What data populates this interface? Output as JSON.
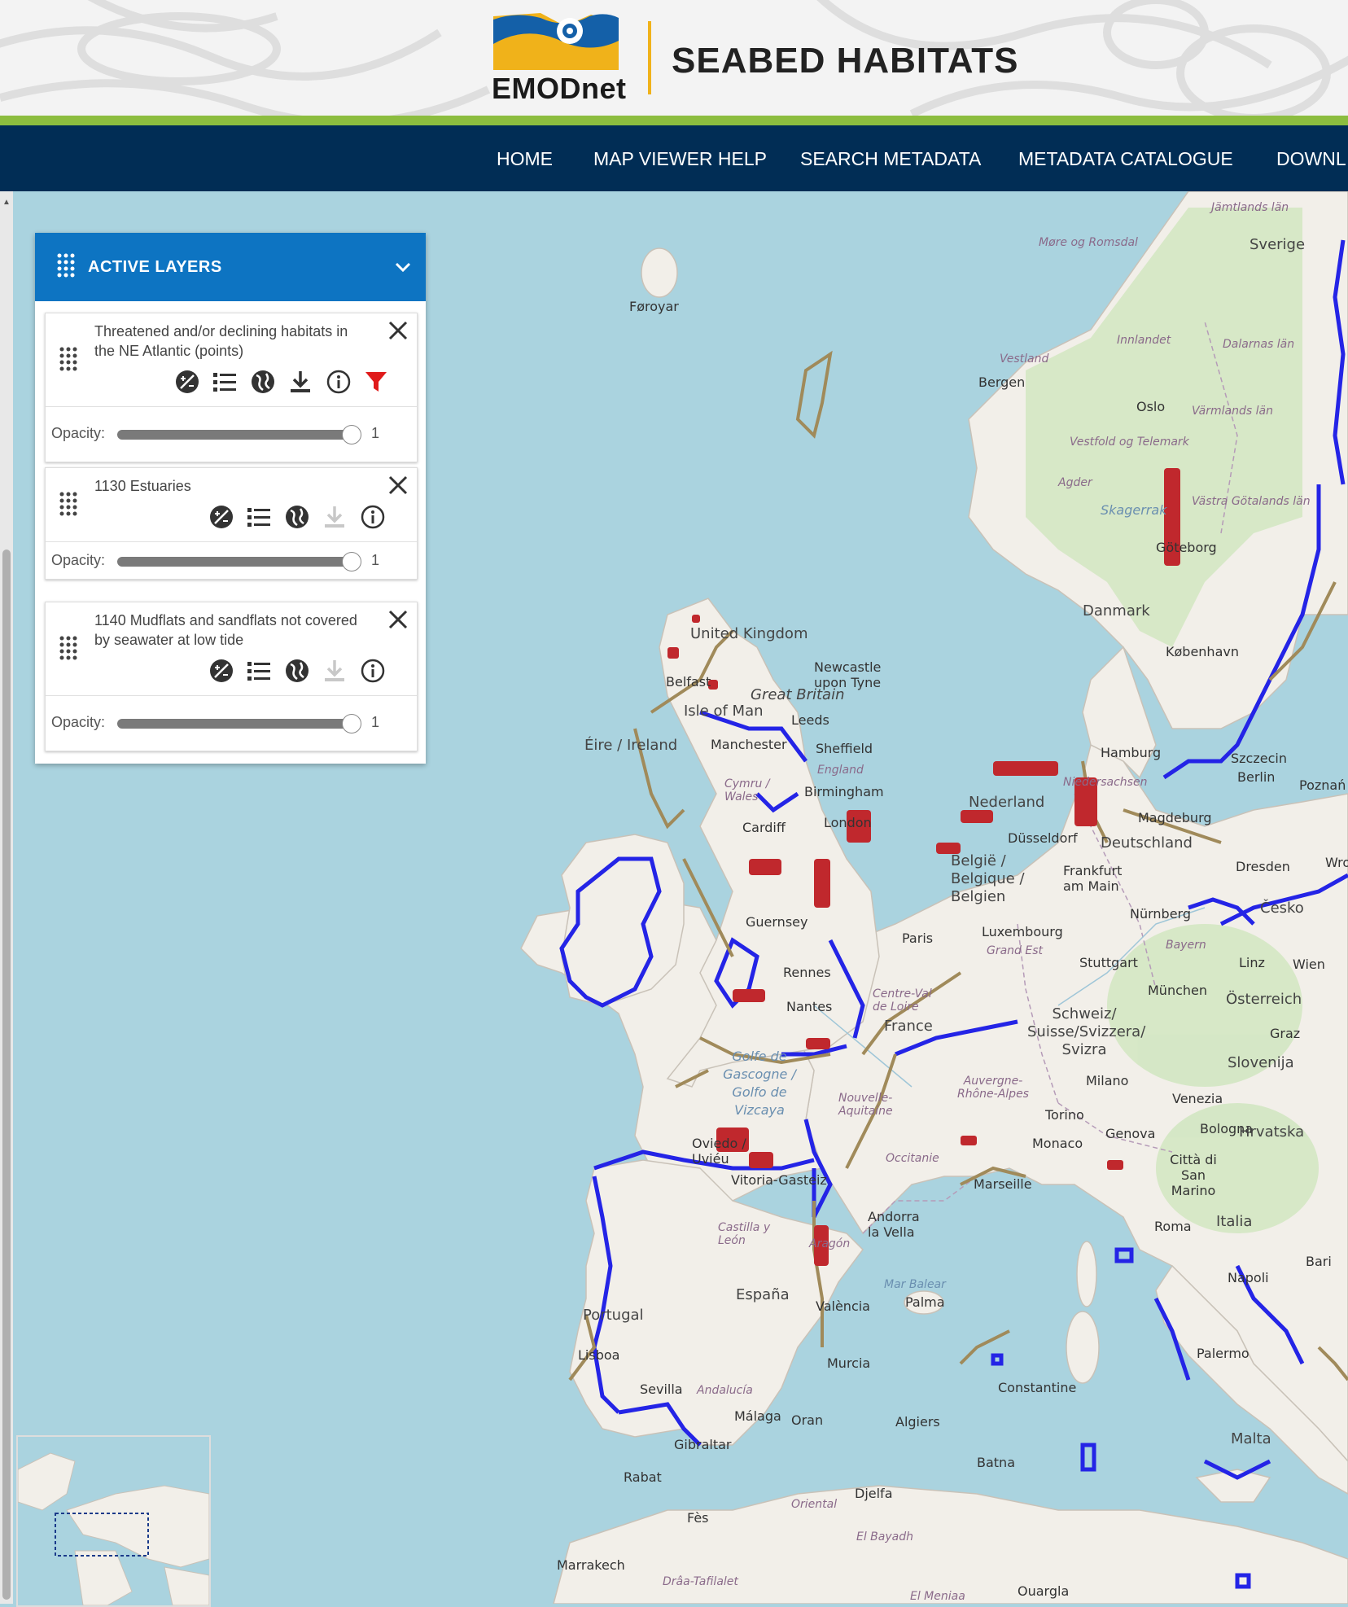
{
  "header": {
    "logo_text": "EMODnet",
    "title": "SEABED HABITATS"
  },
  "nav": {
    "items": [
      "HOME",
      "MAP VIEWER HELP",
      "SEARCH METADATA",
      "METADATA CATALOGUE",
      "DOWNL"
    ]
  },
  "panel": {
    "title": "ACTIVE LAYERS",
    "opacity_label": "Opacity:",
    "layers": [
      {
        "name": "Threatened and/or declining habitats in the NE Atlantic (points)",
        "opacity": 1,
        "download_enabled": true,
        "has_filter": true
      },
      {
        "name": "1130 Estuaries",
        "opacity": 1,
        "download_enabled": false,
        "has_filter": false
      },
      {
        "name": "1140 Mudflats and sandflats not covered by seawater at low tide",
        "opacity": 1,
        "download_enabled": false,
        "has_filter": false
      }
    ]
  },
  "colors": {
    "nav_bg": "#012d55",
    "accent_green": "#8cbd3f",
    "panel_header": "#0d74c2",
    "habitat_points": "#c0282d",
    "estuaries": "#2424e6",
    "mudflats": "#a08a5a",
    "filter_icon": "#e01b1b"
  },
  "map": {
    "labels": [
      "Jämtlands län",
      "Møre og Romsdal",
      "Sverige",
      "Føroyar",
      "Innlandet",
      "Dalarnas län",
      "Vestland",
      "Bergen",
      "Oslo",
      "Värmlands län",
      "Vestfold og Telemark",
      "Agder",
      "Skagerrak",
      "Västra Götalands län",
      "Göteborg",
      "Danmark",
      "København",
      "Hamburg",
      "Szczecin",
      "Berlin",
      "Poznań",
      "Niedersachsen",
      "Magdeburg",
      "Deutschland",
      "Dresden",
      "Wrocław",
      "United Kingdom",
      "Belfast",
      "Isle of Man",
      "Newcastle upon Tyne",
      "Great Britain",
      "Leeds",
      "Éire / Ireland",
      "Manchester",
      "Sheffield",
      "England",
      "Birmingham",
      "Cymru / Wales",
      "Cardiff",
      "London",
      "Nederland",
      "Düsseldorf",
      "België / Belgique / Belgien",
      "Frankfurt am Main",
      "Nürnberg",
      "Česko",
      "Luxembourg",
      "Grand Est",
      "Bayern",
      "Stuttgart",
      "Linz",
      "Wien",
      "München",
      "Österreich",
      "Guernsey",
      "Paris",
      "Rennes",
      "Nantes",
      "Centre-Val de Loire",
      "France",
      "Schweiz/ Suisse/Svizzera/ Svizra",
      "Graz",
      "Slovenija",
      "Golfe de Gascogne / Golfo de Vizcaya",
      "Nouvelle-Aquitaine",
      "Auvergne-Rhône-Alpes",
      "Milano",
      "Venezia",
      "Torino",
      "Genova",
      "Bologna",
      "Hrvatska",
      "Monaco",
      "Oviedo / Uviéu",
      "Vitoria-Gasteiz",
      "Occitanie",
      "Marseille",
      "Città di San Marino",
      "Andorra la Vella",
      "Castilla y León",
      "Aragón",
      "Roma",
      "Italia",
      "Bari",
      "España",
      "València",
      "Mar Balear",
      "Palma",
      "Napoli",
      "Portugal",
      "Lisboa",
      "Murcia",
      "Sevilla",
      "Andalucía",
      "Málaga",
      "Gibraltar",
      "Palermo",
      "Constantine",
      "Oran",
      "Algiers",
      "Batna",
      "Malta",
      "Rabat",
      "Djelfa",
      "Fès",
      "Oriental",
      "El Bayadh",
      "Marrakech",
      "Drâa-Tafilalet",
      "El Meniaa",
      "Ouargla"
    ]
  }
}
